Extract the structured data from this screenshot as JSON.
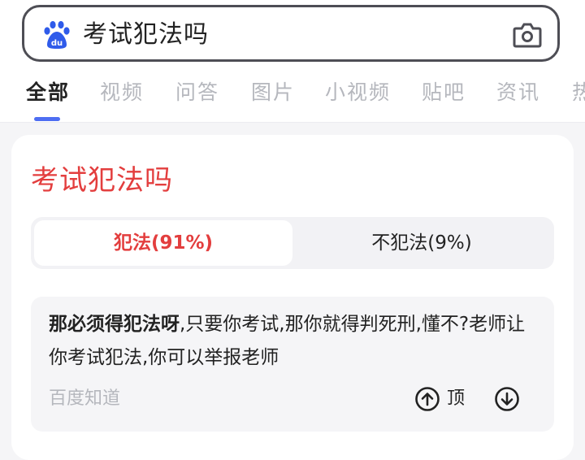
{
  "search": {
    "query": "考试犯法吗"
  },
  "tabs": [
    {
      "label": "全部",
      "active": true
    },
    {
      "label": "视频"
    },
    {
      "label": "问答"
    },
    {
      "label": "图片"
    },
    {
      "label": "小视频"
    },
    {
      "label": "贴吧"
    },
    {
      "label": "资讯"
    },
    {
      "label": "热"
    }
  ],
  "card": {
    "title": "考试犯法吗",
    "options": [
      {
        "label": "犯法(91%)",
        "selected": true
      },
      {
        "label": "不犯法(9%)",
        "selected": false
      }
    ],
    "answer": {
      "bold_text": "那必须得犯法呀",
      "text": ",只要你考试,那你就得判死刑,懂不?老师让你考试犯法,你可以举报老师",
      "source": "百度知道",
      "upvote_label": "顶"
    }
  },
  "colors": {
    "accent": "#e33e3e",
    "brand_blue": "#4e6ef2"
  }
}
